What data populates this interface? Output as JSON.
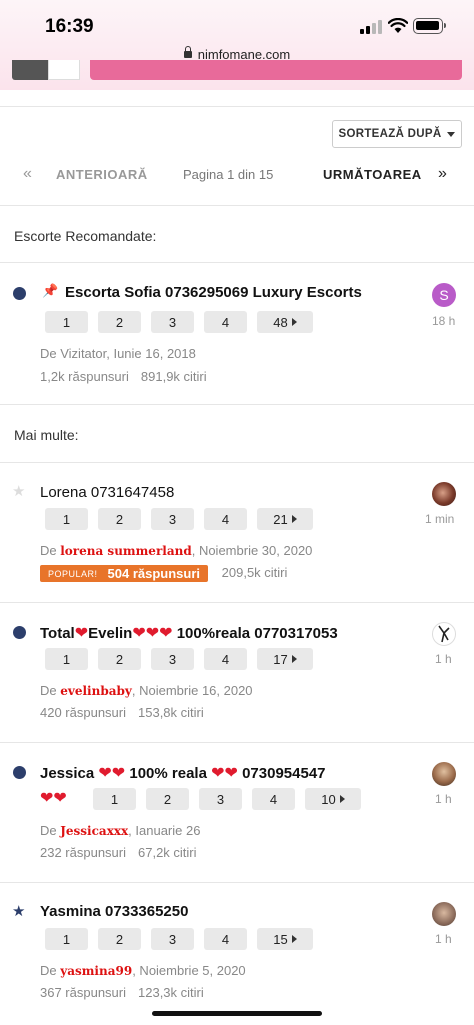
{
  "status_bar": {
    "time": "16:39",
    "url": "nimfomane.com"
  },
  "sort": {
    "label": "SORTEAZĂ DUPĂ"
  },
  "pager": {
    "prev": "ANTERIOARĂ",
    "info": "Pagina 1 din 15",
    "next": "URMĂTOAREA"
  },
  "sections": {
    "featured": "Escorte Recomandate:",
    "more": "Mai multe:"
  },
  "featured": {
    "title": "Escorta Sofia 0736295069 Luxury Escorts",
    "pages": [
      "1",
      "2",
      "3",
      "4",
      "48"
    ],
    "by": "De Vizitator, Iunie 16, 2018",
    "replies": "1,2k răspunsuri",
    "views": "891,9k citiri",
    "avatar_letter": "S",
    "ago": "18 h"
  },
  "topics": [
    {
      "title": "Lorena 0731647458",
      "pages": [
        "1",
        "2",
        "3",
        "4",
        "21"
      ],
      "prefix": "De ",
      "author": "lorena summerland",
      "date": ", Noiembrie 30, 2020",
      "popular_tag": "POPULAR!",
      "replies": "504 răspunsuri",
      "views": "209,5k citiri",
      "ago": "1 min"
    },
    {
      "title_parts": [
        "Total",
        "❤",
        "Evelin",
        "❤❤❤",
        " 100%reala 0770317053"
      ],
      "pages": [
        "1",
        "2",
        "3",
        "4",
        "17"
      ],
      "prefix": "De ",
      "author": "evelinbaby",
      "date": ", Noiembrie 16, 2020",
      "replies": "420 răspunsuri",
      "views": "153,8k citiri",
      "ago": "1 h"
    },
    {
      "title_parts": [
        "Jessica ",
        "❤❤",
        " 100% reala ",
        "❤❤",
        " 0730954547",
        "❤❤"
      ],
      "pages": [
        "1",
        "2",
        "3",
        "4",
        "10"
      ],
      "prefix": "De ",
      "author": "Jessicaxxx",
      "date": ", Ianuarie 26",
      "replies": "232 răspunsuri",
      "views": "67,2k citiri",
      "ago": "1 h"
    },
    {
      "title": "Yasmina 0733365250",
      "pages": [
        "1",
        "2",
        "3",
        "4",
        "15"
      ],
      "prefix": "De ",
      "author": "yasmina99",
      "date": ", Noiembrie 5, 2020",
      "replies": "367 răspunsuri",
      "views": "123,3k citiri",
      "ago": "1 h"
    }
  ],
  "colors": {
    "unread_dot": "#2c3e6b",
    "author": "#dd1111",
    "popular": "#e8742a",
    "pink_button": "#e86a9a"
  }
}
